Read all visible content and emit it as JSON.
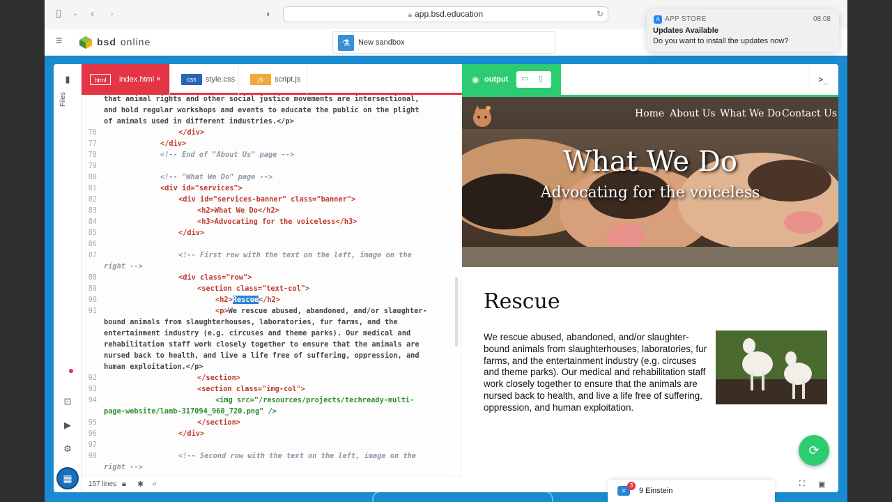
{
  "browser": {
    "url": "app.bsd.education"
  },
  "app": {
    "brand_bold": "bsd",
    "brand_light": "online",
    "sandbox_label": "New sandbox"
  },
  "notification": {
    "app": "APP STORE",
    "time": "08.08",
    "title": "Updates Available",
    "body": "Do you want to install the updates now?"
  },
  "sidebar": {
    "files_label": "Files"
  },
  "tabs": [
    {
      "chip": "html",
      "name": "index.html",
      "close": "×"
    },
    {
      "chip": "css",
      "name": "style.css"
    },
    {
      "chip": "js",
      "name": "script.js"
    }
  ],
  "output": {
    "label": "output",
    "terminal": ">_"
  },
  "status": {
    "lines": "157 lines"
  },
  "code": {
    "c1": "that animal rights and other social justice movements are intersectional,",
    "c2": "and hold regular workshops and events to educate the public on the plight",
    "c3": "of animals used in different industries.</p>",
    "c4": "</div>",
    "c5": "</div>",
    "c6": "<!-- End of \"About Us\" page -->",
    "c8": "<!-- \"What We Do\" page -->",
    "c9": "<div id=\"services\">",
    "c10": "<div id=\"services-banner\" class=\"banner\">",
    "c11": "<h2>What We Do</h2>",
    "c12": "<h3>Advocating for the voiceless</h3>",
    "c13": "</div>",
    "c15": "<!-- First row with the text on the left, image on the",
    "c16": "right -->",
    "c17": "<div class=\"row\">",
    "c18": "<section class=\"text-col\">",
    "c19a": "<h2>",
    "c19b": "Rescue",
    "c19c": "</h2>",
    "c20a": "<p>",
    "c20b": "We rescue abused, abandoned, and/or slaughter-",
    "c21": "bound animals from slaughterhouses, laboratories, fur farms, and the",
    "c22": "entertainment industry (e.g. circuses and theme parks). Our medical and",
    "c23": "rehabilitation staff work closely together to ensure that the animals are",
    "c24": "nursed back to health, and live a life free of suffering, oppression, and",
    "c25": "human exploitation.</p>",
    "c26": "</section>",
    "c27": "<section class=\"img-col\">",
    "c28": "<img src=\"/resources/projects/techready-multi-",
    "c29": "page-website/lamb-317094_960_720.png\" />",
    "c30": "</section>",
    "c31": "</div>",
    "c33": "<!-- Second row with the text on the left, image on the",
    "c34": "right -->",
    "line_numbers": [
      "76",
      "77",
      "78",
      "79",
      "80",
      "81",
      "82",
      "83",
      "84",
      "85",
      "86",
      "87",
      "88",
      "89",
      "90",
      "91",
      "92",
      "93",
      "94",
      "95",
      "96",
      "97",
      "98"
    ]
  },
  "preview": {
    "nav": [
      "Home",
      "About Us",
      "What We Do",
      "Contact Us"
    ],
    "banner_title": "What We Do",
    "banner_subtitle": "Advocating for the voiceless",
    "section_title": "Rescue",
    "section_text": "We rescue abused, abandoned, and/or slaughter-bound animals from slaughterhouses, laboratories, fur farms, and the entertainment industry (e.g. circuses and theme parks). Our medical and rehabilitation staff work closely together to ensure that the animals are nursed back to health, and live a life free of suffering, oppression, and human exploitation."
  },
  "chat": {
    "badge": "3",
    "label": "9 Einstein"
  },
  "colors": {
    "accent_red": "#e23545",
    "accent_green": "#2ecc71",
    "bg_blue": "#1a8ad1"
  }
}
